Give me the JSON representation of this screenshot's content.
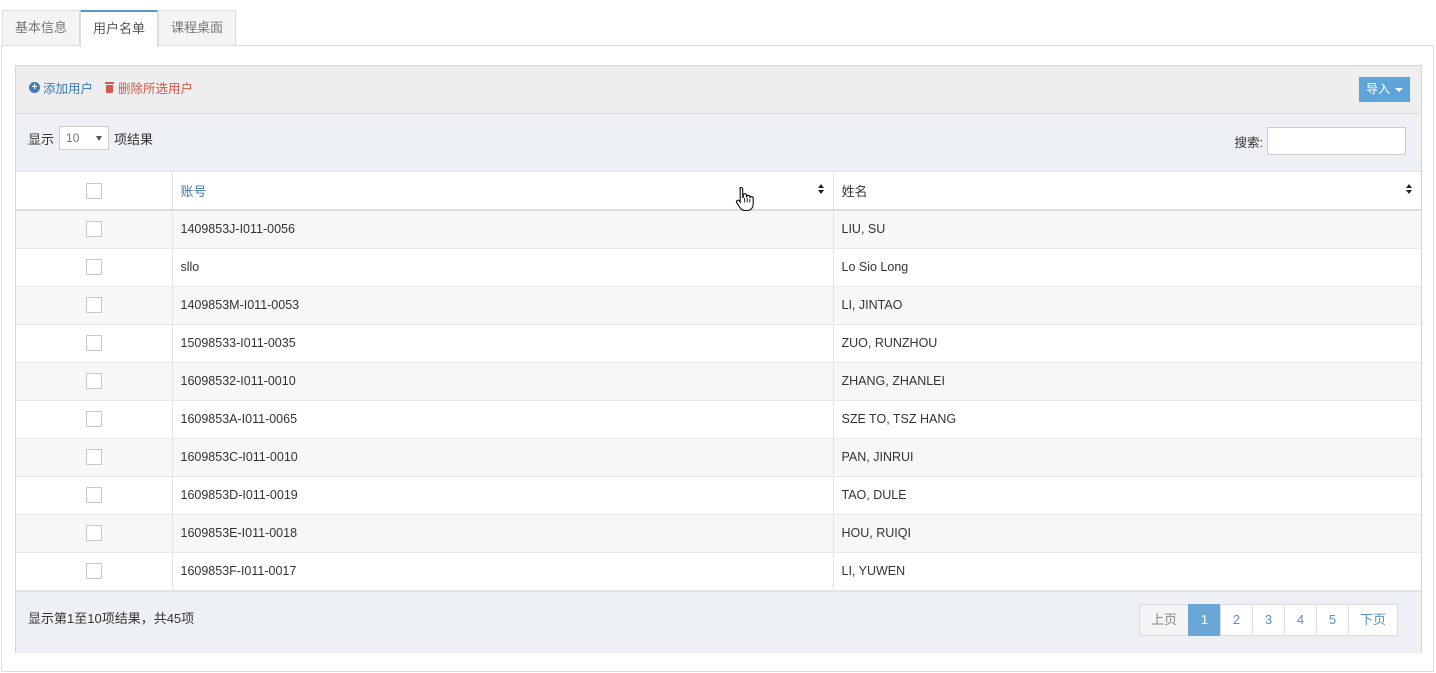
{
  "tabs": [
    {
      "label": "基本信息",
      "active": false
    },
    {
      "label": "用户名单",
      "active": true
    },
    {
      "label": "课程桌面",
      "active": false
    }
  ],
  "toolbar": {
    "add_label": "添加用户",
    "delete_label": "删除所选用户",
    "import_label": "导入"
  },
  "controls": {
    "show_prefix": "显示",
    "page_length": "10",
    "show_suffix": "项结果",
    "search_label": "搜索:",
    "search_value": ""
  },
  "table": {
    "columns": [
      "账号",
      "姓名"
    ],
    "rows": [
      {
        "account": "1409853J-I011-0056",
        "name": "LIU, SU"
      },
      {
        "account": "sllo",
        "name": "Lo Sio Long"
      },
      {
        "account": "1409853M-I011-0053",
        "name": "LI, JINTAO"
      },
      {
        "account": "15098533-I011-0035",
        "name": "ZUO, RUNZHOU"
      },
      {
        "account": "16098532-I011-0010",
        "name": "ZHANG, ZHANLEI"
      },
      {
        "account": "1609853A-I011-0065",
        "name": "SZE TO, TSZ HANG"
      },
      {
        "account": "1609853C-I011-0010",
        "name": "PAN, JINRUI"
      },
      {
        "account": "1609853D-I011-0019",
        "name": "TAO, DULE"
      },
      {
        "account": "1609853E-I011-0018",
        "name": "HOU, RUIQI"
      },
      {
        "account": "1609853F-I011-0017",
        "name": "LI, YUWEN"
      }
    ]
  },
  "footer": {
    "info": "显示第1至10项结果，共45项",
    "prev_label": "上页",
    "next_label": "下页",
    "pages": [
      "1",
      "2",
      "3",
      "4",
      "5"
    ],
    "current_page": "1"
  },
  "colors": {
    "accent": "#5ea4d8",
    "link": "#3c7ab8",
    "danger": "#d2594c"
  },
  "icons": {
    "add": "plus-circle-icon",
    "delete": "trash-icon",
    "sort": "sort-icon"
  }
}
